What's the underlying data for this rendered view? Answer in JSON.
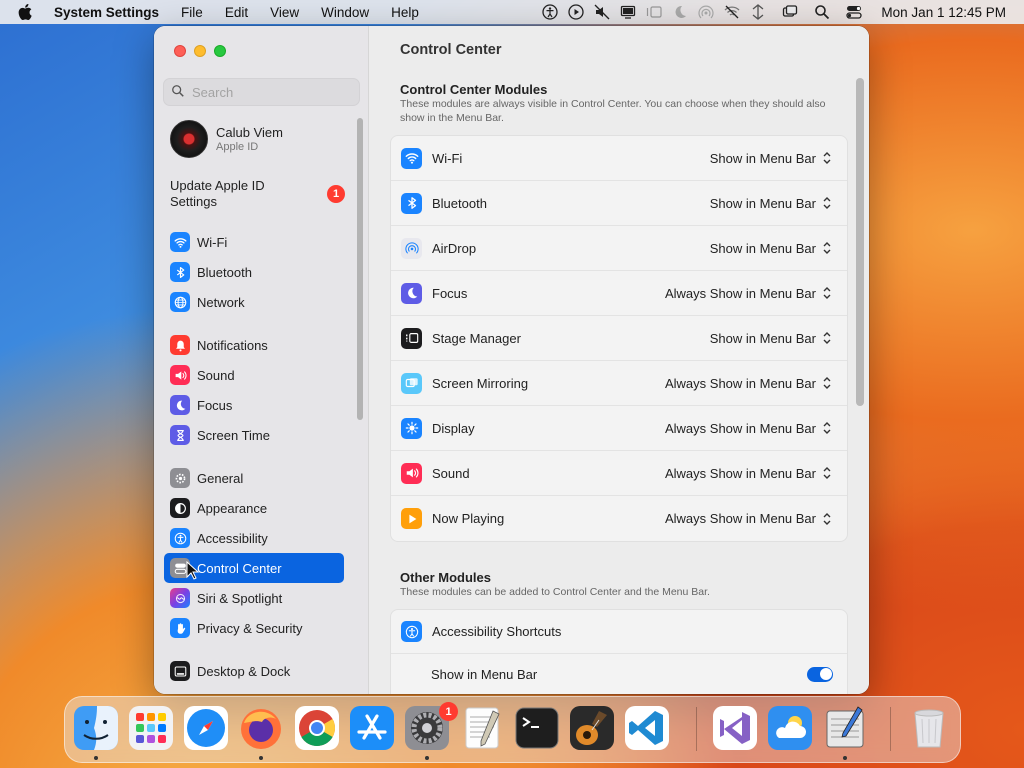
{
  "menubar": {
    "app_name": "System Settings",
    "menus": [
      "File",
      "Edit",
      "View",
      "Window",
      "Help"
    ],
    "status_icons": [
      "accessibility-icon",
      "play-icon",
      "mute-icon",
      "display-icon",
      "stage-manager-icon",
      "focus-moon-icon",
      "airdrop-icon",
      "wifi-off-icon",
      "network-icon",
      "screen-mirroring-icon",
      "spotlight-search-icon",
      "control-center-icon"
    ],
    "clock": "Mon Jan 1  12:45 PM"
  },
  "sidebar": {
    "search_placeholder": "Search",
    "account": {
      "name": "Calub Viem",
      "subtitle": "Apple ID"
    },
    "update": {
      "label": "Update Apple ID Settings",
      "badge": "1"
    },
    "groups": [
      [
        {
          "label": "Wi-Fi",
          "icon": "wifi-icon",
          "color": "#1a84ff"
        },
        {
          "label": "Bluetooth",
          "icon": "bluetooth-icon",
          "color": "#1a84ff"
        },
        {
          "label": "Network",
          "icon": "globe-icon",
          "color": "#1a84ff"
        }
      ],
      [
        {
          "label": "Notifications",
          "icon": "bell-icon",
          "color": "#ff3b30"
        },
        {
          "label": "Sound",
          "icon": "speaker-icon",
          "color": "#ff2d55"
        },
        {
          "label": "Focus",
          "icon": "moon-icon",
          "color": "#5e5ce6"
        },
        {
          "label": "Screen Time",
          "icon": "hourglass-icon",
          "color": "#5e5ce6"
        }
      ],
      [
        {
          "label": "General",
          "icon": "gear-icon",
          "color": "#8e8e93"
        },
        {
          "label": "Appearance",
          "icon": "appearance-icon",
          "color": "#1c1c1e"
        },
        {
          "label": "Accessibility",
          "icon": "accessibility-icon",
          "color": "#1a84ff"
        },
        {
          "label": "Control Center",
          "icon": "control-center-icon",
          "color": "#8e8e93",
          "selected": true
        },
        {
          "label": "Siri & Spotlight",
          "icon": "siri-icon",
          "color": "#7b3fe4"
        },
        {
          "label": "Privacy & Security",
          "icon": "hand-icon",
          "color": "#1a84ff"
        }
      ],
      [
        {
          "label": "Desktop & Dock",
          "icon": "dock-icon",
          "color": "#1c1c1e"
        }
      ]
    ]
  },
  "main": {
    "title": "Control Center",
    "modules_section": {
      "title": "Control Center Modules",
      "description": "These modules are always visible in Control Center. You can choose when they should also show in the Menu Bar.",
      "rows": [
        {
          "label": "Wi-Fi",
          "value": "Show in Menu Bar",
          "icon": "wifi-icon",
          "color": "#1a84ff"
        },
        {
          "label": "Bluetooth",
          "value": "Show in Menu Bar",
          "icon": "bluetooth-icon",
          "color": "#1a84ff"
        },
        {
          "label": "AirDrop",
          "value": "Show in Menu Bar",
          "icon": "airdrop-icon",
          "color": "#e8e8ee"
        },
        {
          "label": "Focus",
          "value": "Always Show in Menu Bar",
          "icon": "moon-icon",
          "color": "#5e5ce6"
        },
        {
          "label": "Stage Manager",
          "value": "Show in Menu Bar",
          "icon": "stage-manager-icon",
          "color": "#1c1c1e"
        },
        {
          "label": "Screen Mirroring",
          "value": "Always Show in Menu Bar",
          "icon": "screen-mirroring-icon",
          "color": "#5ac8fa"
        },
        {
          "label": "Display",
          "value": "Always Show in Menu Bar",
          "icon": "sun-icon",
          "color": "#1a84ff"
        },
        {
          "label": "Sound",
          "value": "Always Show in Menu Bar",
          "icon": "speaker-icon",
          "color": "#ff2d55"
        },
        {
          "label": "Now Playing",
          "value": "Always Show in Menu Bar",
          "icon": "play-icon",
          "color": "#ff9f0a"
        }
      ]
    },
    "other_section": {
      "title": "Other Modules",
      "description": "These modules can be added to Control Center and the Menu Bar.",
      "accessibility_shortcuts": {
        "label": "Accessibility Shortcuts",
        "icon": "accessibility-icon",
        "color": "#1a84ff"
      },
      "show_in_menu_bar": {
        "label": "Show in Menu Bar",
        "checked": true
      }
    }
  },
  "dock": {
    "apps": [
      {
        "name": "Finder",
        "icon": "finder-icon",
        "running": true
      },
      {
        "name": "Launchpad",
        "icon": "launchpad-icon",
        "running": false
      },
      {
        "name": "Safari",
        "icon": "safari-icon",
        "running": false
      },
      {
        "name": "Firefox",
        "icon": "firefox-icon",
        "running": true
      },
      {
        "name": "Chrome",
        "icon": "chrome-icon",
        "running": false
      },
      {
        "name": "App Store",
        "icon": "app-store-icon",
        "running": false
      },
      {
        "name": "System Settings",
        "icon": "system-settings-icon",
        "running": true,
        "badge": "1"
      },
      {
        "name": "TextEdit",
        "icon": "textedit-icon",
        "running": false
      },
      {
        "name": "Terminal",
        "icon": "terminal-icon",
        "running": false
      },
      {
        "name": "GarageBand",
        "icon": "garageband-icon",
        "running": false
      },
      {
        "name": "Visual Studio Code",
        "icon": "vscode-icon",
        "running": false
      },
      {
        "name": "Visual Studio",
        "icon": "visual-studio-icon",
        "running": false
      },
      {
        "name": "Weather",
        "icon": "weather-icon",
        "running": false
      },
      {
        "name": "Script Editor",
        "icon": "script-editor-icon",
        "running": true
      },
      {
        "name": "Trash",
        "icon": "trash-icon",
        "running": false
      }
    ]
  }
}
